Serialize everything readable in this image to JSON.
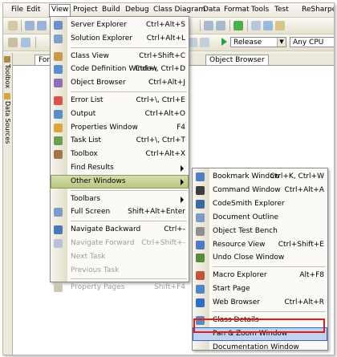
{
  "menubar": [
    {
      "label": "File"
    },
    {
      "label": "Edit"
    },
    {
      "label": "View",
      "active": true
    },
    {
      "label": "Project"
    },
    {
      "label": "Build"
    },
    {
      "label": "Debug"
    },
    {
      "label": "Class Diagram"
    },
    {
      "label": "Data"
    },
    {
      "label": "Format"
    },
    {
      "label": "Tools"
    },
    {
      "label": "Test"
    },
    {
      "label": "ReSharper"
    }
  ],
  "toolbar": {
    "config": "Release",
    "platform": "Any CPU"
  },
  "tabs": [
    {
      "label": "Formb"
    },
    {
      "label": "Object Browser"
    }
  ],
  "side_tabs": [
    {
      "label": "Toolbox"
    },
    {
      "label": "Data Sources"
    }
  ],
  "view_menu": [
    {
      "label": "Server Explorer",
      "shortcut": "Ctrl+Alt+S",
      "icon": "server-explorer-icon",
      "color": "#6b8fc7"
    },
    {
      "label": "Solution Explorer",
      "shortcut": "Ctrl+Alt+L",
      "icon": "solution-explorer-icon",
      "color": "#7fa0c8"
    },
    {
      "sep": true
    },
    {
      "label": "Class View",
      "shortcut": "Ctrl+Shift+C",
      "icon": "class-view-icon",
      "color": "#c89b4a"
    },
    {
      "label": "Code Definition Window",
      "shortcut": "Ctrl+\\, Ctrl+D",
      "icon": "code-definition-icon",
      "color": "#5a8dc9"
    },
    {
      "label": "Object Browser",
      "shortcut": "Ctrl+Alt+J",
      "icon": "object-browser-icon",
      "color": "#8d6fb5"
    },
    {
      "sep": true
    },
    {
      "label": "Error List",
      "shortcut": "Ctrl+\\, Ctrl+E",
      "icon": "error-list-icon",
      "color": "#d9534f"
    },
    {
      "label": "Output",
      "shortcut": "Ctrl+Alt+O",
      "icon": "output-icon",
      "color": "#5b8ec4"
    },
    {
      "label": "Properties Window",
      "shortcut": "F4",
      "icon": "properties-icon",
      "color": "#d8a63c"
    },
    {
      "label": "Task List",
      "shortcut": "Ctrl+\\, Ctrl+T",
      "icon": "task-list-icon",
      "color": "#6a9f4c"
    },
    {
      "label": "Toolbox",
      "shortcut": "Ctrl+Alt+X",
      "icon": "toolbox-icon",
      "color": "#a0764a"
    },
    {
      "label": "Find Results",
      "submenu": true
    },
    {
      "label": "Other Windows",
      "submenu": true,
      "highlight": true
    },
    {
      "sep": true
    },
    {
      "label": "Toolbars",
      "submenu": true
    },
    {
      "label": "Full Screen",
      "shortcut": "Shift+Alt+Enter",
      "icon": "full-screen-icon",
      "color": "#7c9bc7"
    },
    {
      "sep": true
    },
    {
      "label": "Navigate Backward",
      "shortcut": "Ctrl+-",
      "icon": "navigate-backward-icon",
      "color": "#4a78b8"
    },
    {
      "label": "Navigate Forward",
      "shortcut": "Ctrl+Shift+-",
      "icon": "navigate-forward-icon",
      "color": "#b7c3d4",
      "disabled": true
    },
    {
      "label": "Next Task",
      "disabled": true
    },
    {
      "label": "Previous Task",
      "disabled": true
    },
    {
      "sep": true
    },
    {
      "label": "Property Pages",
      "shortcut": "Shift+F4",
      "icon": "property-pages-icon",
      "color": "#cfc7b3",
      "disabled": true
    }
  ],
  "other_windows_menu": [
    {
      "label": "Bookmark Window",
      "shortcut": "Ctrl+K, Ctrl+W",
      "icon": "bookmark-icon",
      "color": "#4f7fbf"
    },
    {
      "label": "Command Window",
      "shortcut": "Ctrl+Alt+A",
      "icon": "command-window-icon",
      "color": "#3d3d3d"
    },
    {
      "label": "CodeSmith Explorer",
      "icon": "codesmith-icon",
      "color": "#3b6aa0"
    },
    {
      "label": "Document Outline",
      "icon": "document-outline-icon",
      "color": "#7d9bc4"
    },
    {
      "label": "Object Test Bench",
      "icon": "object-test-bench-icon",
      "color": "#8f8f8f"
    },
    {
      "label": "Resource View",
      "shortcut": "Ctrl+Shift+E",
      "icon": "resource-view-icon",
      "color": "#4d7ac2"
    },
    {
      "label": "Undo Close Window",
      "icon": "undo-close-icon",
      "color": "#5a8a3e"
    },
    {
      "sep": true
    },
    {
      "label": "Macro Explorer",
      "shortcut": "Alt+F8",
      "icon": "macro-explorer-icon",
      "color": "#c2543a"
    },
    {
      "label": "Start Page",
      "icon": "start-page-icon",
      "color": "#4f86c6"
    },
    {
      "label": "Web Browser",
      "shortcut": "Ctrl+Alt+R",
      "icon": "web-browser-icon",
      "color": "#2f6ec4"
    },
    {
      "sep": true
    },
    {
      "label": "Class Details",
      "icon": "class-details-icon",
      "color": "#5d87bd"
    },
    {
      "label": "Pan & Zoom Window",
      "highlight": true
    },
    {
      "label": "Documentation Window"
    }
  ],
  "colors": {
    "highlight_red": "#e21b1b",
    "submenu_hover": "#c1d2ee"
  }
}
